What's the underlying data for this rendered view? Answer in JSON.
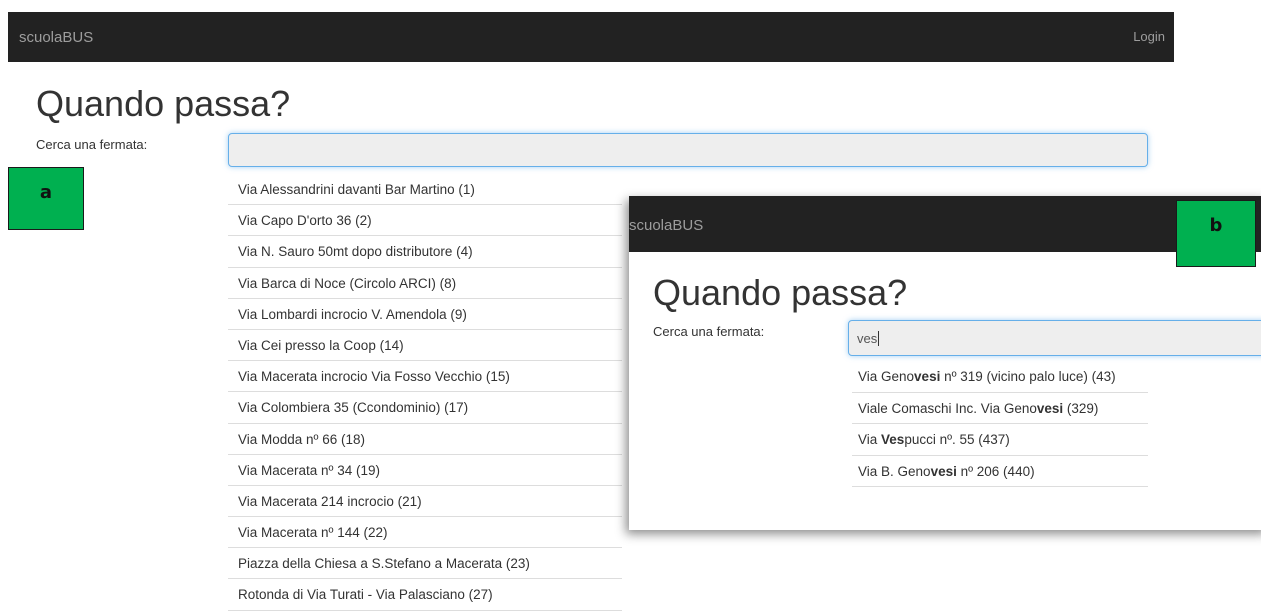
{
  "screen_a": {
    "navbar": {
      "brand": "scuolaBUS",
      "login": "Login"
    },
    "title": "Quando passa?",
    "search_label": "Cerca una fermata:",
    "search_value": "",
    "stops": [
      "Via Alessandrini davanti Bar Martino (1)",
      "Via Capo D'orto 36 (2)",
      "Via N. Sauro 50mt dopo distributore (4)",
      "Via Barca di Noce (Circolo ARCI) (8)",
      "Via Lombardi incrocio V. Amendola (9)",
      "Via Cei presso la Coop (14)",
      "Via Macerata incrocio Via Fosso Vecchio (15)",
      "Via Colombiera 35 (Ccondominio) (17)",
      "Via Modda nº 66 (18)",
      "Via Macerata nº 34 (19)",
      "Via Macerata 214 incrocio (21)",
      "Via Macerata nº 144 (22)",
      "Piazza della Chiesa a S.Stefano a Macerata (23)",
      "Rotonda di Via Turati - Via Palasciano (27)"
    ]
  },
  "screen_b": {
    "navbar": {
      "brand": "scuolaBUS"
    },
    "title": "Quando passa?",
    "search_label": "Cerca una fermata:",
    "search_value": "ves",
    "results": [
      {
        "before": "Via Geno",
        "match": "vesi",
        "after": " nº 319 (vicino palo luce) (43)"
      },
      {
        "before": "Viale Comaschi Inc. Via Geno",
        "match": "vesi",
        "after": " (329)"
      },
      {
        "before": "Via ",
        "match": "Ves",
        "after": "pucci nº. 55 (437)"
      },
      {
        "before": "Via B. Geno",
        "match": "vesi",
        "after": " nº 206 (440)"
      }
    ]
  },
  "labels": {
    "a": "a",
    "b": "b"
  },
  "colors": {
    "navbar": "#222222",
    "badge": "#00b050",
    "focus": "#66afe9"
  }
}
